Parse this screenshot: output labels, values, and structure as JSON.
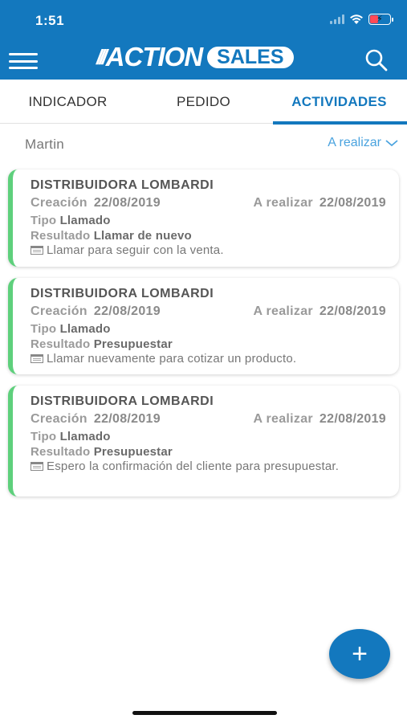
{
  "status_bar": {
    "time": "1:51"
  },
  "header": {
    "logo_slashes": "///",
    "logo_action": "ACTION",
    "logo_sales": "SALES"
  },
  "tabs": [
    {
      "label": "INDICADOR",
      "active": false
    },
    {
      "label": "PEDIDO",
      "active": false
    },
    {
      "label": "ACTIVIDADES",
      "active": true
    }
  ],
  "filter": {
    "user": "Martin",
    "date_type": "A realizar"
  },
  "activities": [
    {
      "client": "DISTRIBUIDORA LOMBARDI",
      "creacion_label": "Creación",
      "creacion_date": "22/08/2019",
      "realizar_label": "A realizar",
      "realizar_date": "22/08/2019",
      "tipo_label": "Tipo",
      "tipo": "Llamado",
      "resultado_label": "Resultado",
      "resultado": "Llamar de nuevo",
      "note": "Llamar para seguir con la venta."
    },
    {
      "client": "DISTRIBUIDORA LOMBARDI",
      "creacion_label": "Creación",
      "creacion_date": "22/08/2019",
      "realizar_label": "A realizar",
      "realizar_date": "22/08/2019",
      "tipo_label": "Tipo",
      "tipo": "Llamado",
      "resultado_label": "Resultado",
      "resultado": "Presupuestar",
      "note": "Llamar nuevamente para cotizar un producto."
    },
    {
      "client": "DISTRIBUIDORA LOMBARDI",
      "creacion_label": "Creación",
      "creacion_date": "22/08/2019",
      "realizar_label": "A realizar",
      "realizar_date": "22/08/2019",
      "tipo_label": "Tipo",
      "tipo": "Llamado",
      "resultado_label": "Resultado",
      "resultado": "Presupuestar",
      "note": "Espero la confirmación del cliente para presupuestar."
    }
  ],
  "fab": {
    "label": "+"
  },
  "colors": {
    "primary": "#1378be",
    "accent_light": "#4aa3df",
    "card_stripe": "#5ed07c",
    "battery_low": "#ff4a57"
  }
}
